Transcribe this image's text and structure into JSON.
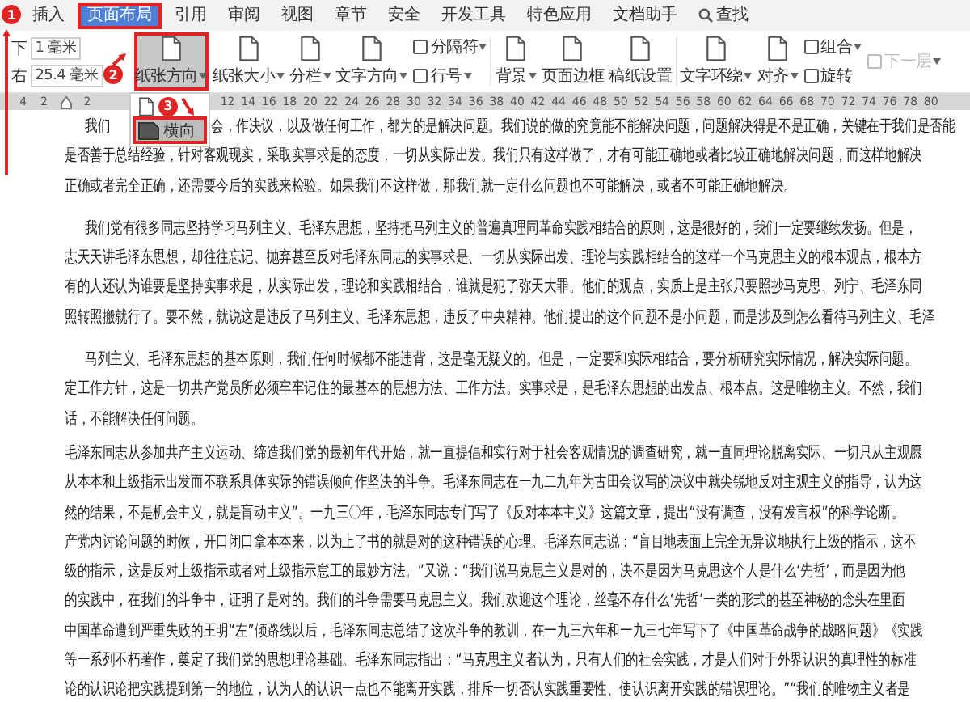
{
  "menu_tabs": [
    {
      "label": "插入",
      "selected": false,
      "highlighted": false
    },
    {
      "label": "页面布局",
      "selected": true,
      "highlighted": true
    },
    {
      "label": "引用",
      "selected": false,
      "highlighted": false
    },
    {
      "label": "审阅",
      "selected": false,
      "highlighted": false
    },
    {
      "label": "视图",
      "selected": false,
      "highlighted": false
    },
    {
      "label": "章节",
      "selected": false,
      "highlighted": false
    },
    {
      "label": "安全",
      "selected": false,
      "highlighted": false
    },
    {
      "label": "开发工具",
      "selected": false,
      "highlighted": false
    },
    {
      "label": "特色应用",
      "selected": false,
      "highlighted": false
    },
    {
      "label": "文档助手",
      "selected": false,
      "highlighted": false
    }
  ],
  "search": {
    "label": "查找"
  },
  "margins": [
    {
      "label": "下",
      "value": "1 毫米"
    },
    {
      "label": "右",
      "value": "25.4 毫米"
    }
  ],
  "ribbon": [
    {
      "kind": "large",
      "label": "纸张方向",
      "dropdown": true,
      "pressed": true,
      "highlighted": true
    },
    {
      "kind": "large",
      "label": "纸张大小",
      "dropdown": true,
      "pressed": false,
      "highlighted": false
    },
    {
      "kind": "large",
      "label": "分栏",
      "dropdown": true,
      "pressed": false,
      "highlighted": false
    },
    {
      "kind": "large",
      "label": "文字方向",
      "dropdown": true,
      "pressed": false,
      "highlighted": false
    },
    {
      "kind": "stack",
      "items": [
        {
          "label": "分隔符",
          "dropdown": true,
          "disabled": false
        },
        {
          "label": "行号",
          "dropdown": true,
          "disabled": false
        }
      ]
    },
    {
      "kind": "large",
      "label": "背景",
      "dropdown": true,
      "pressed": false,
      "highlighted": false
    },
    {
      "kind": "large",
      "label": "页面边框",
      "dropdown": false,
      "pressed": false,
      "highlighted": false
    },
    {
      "kind": "large",
      "label": "稿纸设置",
      "dropdown": false,
      "pressed": false,
      "highlighted": false
    },
    {
      "kind": "large",
      "label": "文字环绕",
      "dropdown": true,
      "pressed": false,
      "highlighted": false
    },
    {
      "kind": "large",
      "label": "对齐",
      "dropdown": true,
      "pressed": false,
      "highlighted": false
    },
    {
      "kind": "stack",
      "items": [
        {
          "label": "组合",
          "dropdown": true,
          "disabled": false
        },
        {
          "label": "旋转",
          "dropdown": false,
          "disabled": false
        }
      ]
    },
    {
      "kind": "stack",
      "items": [
        {
          "label": "下一层",
          "dropdown": true,
          "disabled": true
        }
      ]
    }
  ],
  "ruler": {
    "left_ticks": [
      "4",
      "2"
    ],
    "ticks": [
      "2"
    ],
    "ticks_after_menu": [
      "12",
      "14",
      "16",
      "18",
      "20",
      "22",
      "24",
      "26",
      "28",
      "30",
      "32",
      "34",
      "36",
      "38",
      "40",
      "42",
      "44",
      "46",
      "48",
      "50",
      "52",
      "54",
      "56",
      "58",
      "60",
      "62",
      "64",
      "66",
      "68",
      "70",
      "72",
      "74",
      "76",
      "78",
      "80"
    ]
  },
  "orientation_menu": {
    "items": [
      {
        "kind": "portrait",
        "selected": false,
        "highlighted": false
      },
      {
        "kind": "landscape",
        "label": "横向",
        "selected": true,
        "highlighted": true
      }
    ]
  },
  "callouts": [
    "1",
    "2",
    "3"
  ],
  "document": {
    "paragraphs": [
      {
        "indent": true,
        "lines": [
          [
            "我们",
            "会，作决议，以及做任何工作，都为的是解决问题。我们说的做的究竟能不能解决问题，问题解决得是不是正确，关键在于我们是否能"
          ],
          "是否善于总结经验，针对客观现实，采取实事求是的态度，一切从实际出发。我们只有这样做了，才有可能正确地或者比较正确地解决问题，而这样地解决",
          "正确或者完全正确，还需要今后的实践来检验。如果我们不这样做，那我们就一定什么问题也不可能解决，或者不可能正确地解决。"
        ]
      },
      {
        "indent": true,
        "lines": [
          "我们党有很多同志坚持学习马列主义、毛泽东思想，坚持把马列主义的普遍真理同革命实践相结合的原则，这是很好的，我们一定要继续发扬。但是，",
          "志天天讲毛泽东思想，却往往忘记、抛弃甚至反对毛泽东同志的实事求是、一切从实际出发、理论与实践相结合的这样一个马克思主义的根本观点，根本方",
          "有的人还认为谁要是坚持实事求是，从实际出发，理论和实践相结合，谁就是犯了弥天大罪。他们的观点，实质上是主张只要照抄马克思、列宁、毛泽东同",
          "照转照搬就行了。要不然，就说这是违反了马列主义、毛泽东思想，违反了中央精神。他们提出的这个问题不是小问题，而是涉及到怎么看待马列主义、毛泽"
        ]
      },
      {
        "indent": true,
        "lines": [
          "马列主义、毛泽东思想的基本原则，我们任何时候都不能违背，这是毫无疑义的。但是，一定要和实际相结合，要分析研究实际情况，解决实际问题。",
          "定工作方针，这是一切共产党员所必须牢牢记住的最基本的思想方法、工作方法。实事求是，是毛泽东思想的出发点、根本点。这是唯物主义。不然，我们",
          "话，不能解决任何问题。"
        ]
      },
      {
        "indent": false,
        "lines": [
          "毛泽东同志从参加共产主义运动、缔造我们党的最初年代开始，就一直提倡和实行对于社会客观情况的调查研究，就一直同理论脱离实际、一切只从主观愿",
          "从本本和上级指示出发而不联系具体实际的错误倾向作坚决的斗争。毛泽东同志在一九二九年为古田会议写的决议中就尖锐地反对主观主义的指导，认为这",
          "然的结果，不是机会主义，就是盲动主义”。一九三〇年，毛泽东同志专门写了《反对本本主义》这篇文章，提出“没有调查，没有发言权”的科学论断。",
          "产党内讨论问题的时候，开口闭口拿本本来，以为上了书的就是对的这种错误的心理。毛泽东同志说：“盲目地表面上完全无异议地执行上级的指示，这不",
          "级的指示，这是反对上级指示或者对上级指示怠工的最妙方法。”又说：“我们说马克思主义是对的，决不是因为马克思这个人是什么‘先哲’，而是因为他",
          "的实践中，在我们的斗争中，证明了是对的。我们的斗争需要马克思主义。我们欢迎这个理论，丝毫不存什么‘先哲’一类的形式的甚至神秘的念头在里面",
          "中国革命遭到严重失败的王明“左”倾路线以后，毛泽东同志总结了这次斗争的教训，在一九三六年和一九三七年写下了《中国革命战争的战略问题》《实践",
          "等一系列不朽著作，奠定了我们党的思想理论基础。毛泽东同志指出：“马克思主义者认为，只有人们的社会实践，才是人们对于外界认识的真理性的标准",
          "论的认识论把实践提到第一的地位，认为人的认识一点也不能离开实践，排斥一切否认实践重要性、使认识离开实践的错误理论。”“我们的唯物主义者是"
        ]
      }
    ]
  }
}
